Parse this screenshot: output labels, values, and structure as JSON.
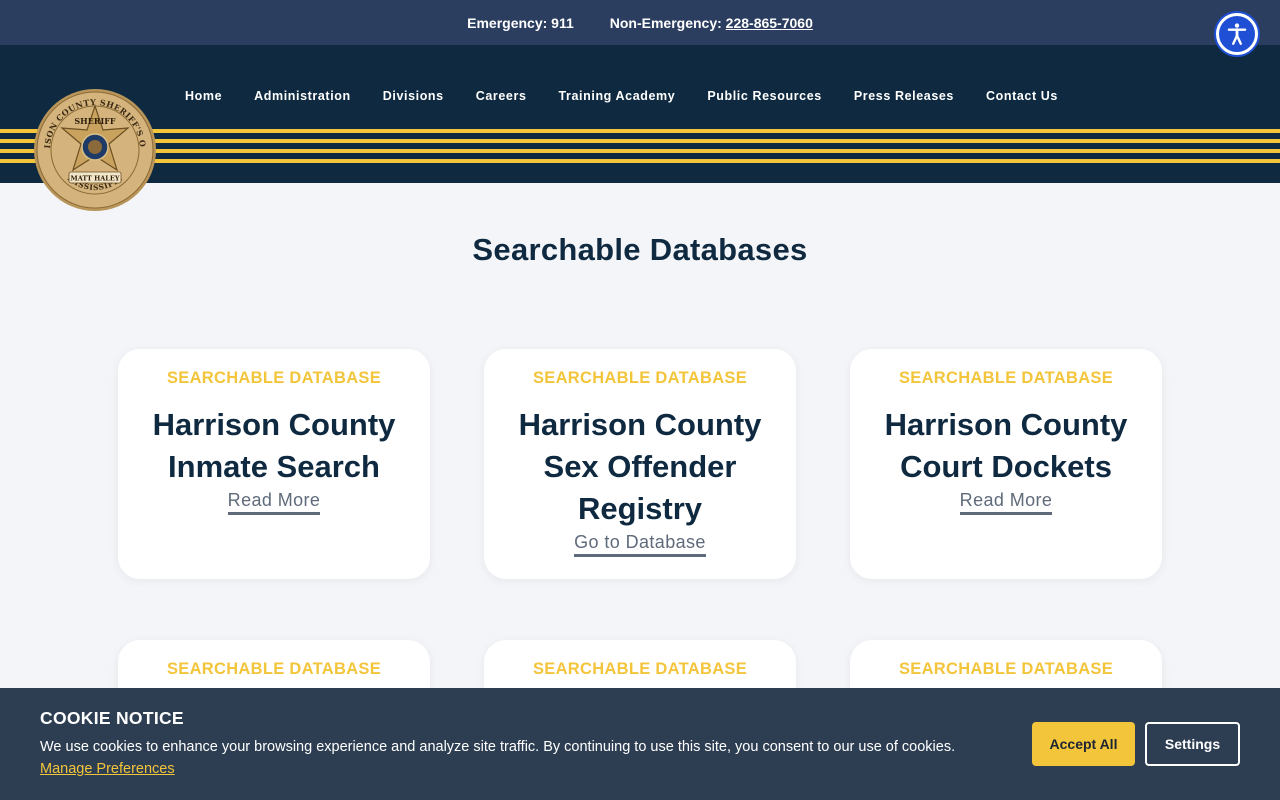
{
  "topbar": {
    "emergency_label": "Emergency: 911",
    "non_emergency_label": "Non-Emergency:",
    "non_emergency_phone": "228-865-7060"
  },
  "accessibility": {
    "icon": "accessibility-icon"
  },
  "logo": {
    "text_top": "HARRISON COUNTY SHERIFF'S OFFICE",
    "star_text": "SHERIFF",
    "banner_text": "MATT HALEY",
    "text_bottom": "MISSISSIPPI"
  },
  "nav": {
    "items": [
      {
        "label": "Home"
      },
      {
        "label": "Administration"
      },
      {
        "label": "Divisions"
      },
      {
        "label": "Careers"
      },
      {
        "label": "Training Academy"
      },
      {
        "label": "Public Resources"
      },
      {
        "label": "Press Releases"
      },
      {
        "label": "Contact Us"
      }
    ]
  },
  "main": {
    "title": "Searchable Databases",
    "cards": [
      {
        "kicker": "SEARCHABLE DATABASE",
        "title": "Harrison County Inmate Search",
        "link": "Read More"
      },
      {
        "kicker": "SEARCHABLE DATABASE",
        "title": "Harrison County Sex Offender Registry",
        "link": "Go to Database"
      },
      {
        "kicker": "SEARCHABLE DATABASE",
        "title": "Harrison County Court Dockets",
        "link": "Read More"
      },
      {
        "kicker": "SEARCHABLE DATABASE"
      },
      {
        "kicker": "SEARCHABLE DATABASE"
      },
      {
        "kicker": "SEARCHABLE DATABASE"
      }
    ]
  },
  "cookie": {
    "title": "COOKIE NOTICE",
    "text": "We use cookies to enhance your browsing experience and analyze site traffic. By continuing to use this site, you consent to our use of cookies.",
    "manage_link": "Manage Preferences",
    "accept_label": "Accept All",
    "settings_label": "Settings"
  },
  "colors": {
    "navy": "#0f2a40",
    "topbar": "#2c3e60",
    "gold": "#f3c53b",
    "cookie_bg": "#2d3e52",
    "accessibility_blue": "#1f4fd4"
  }
}
